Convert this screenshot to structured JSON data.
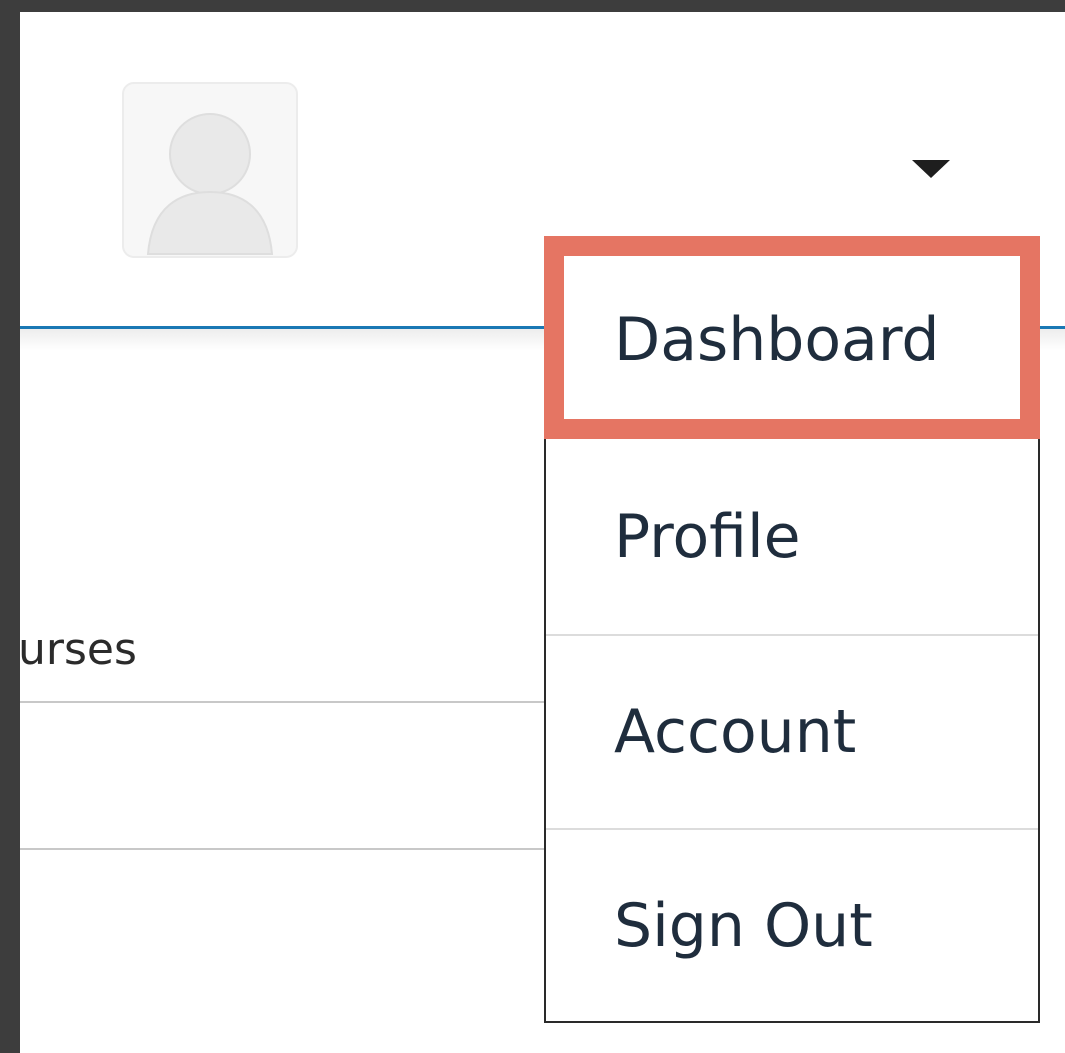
{
  "header": {
    "avatar_icon": "user-avatar-icon",
    "menu_toggle_icon": "caret-down-icon",
    "rule_color": "#1a78b4"
  },
  "content": {
    "courses_label": "urses"
  },
  "user_menu": {
    "items": [
      {
        "label": "Dashboard",
        "highlighted": true
      },
      {
        "label": "Profile",
        "highlighted": false
      },
      {
        "label": "Account",
        "highlighted": false
      },
      {
        "label": "Sign Out",
        "highlighted": false
      }
    ],
    "highlight_color": "#e57563"
  }
}
